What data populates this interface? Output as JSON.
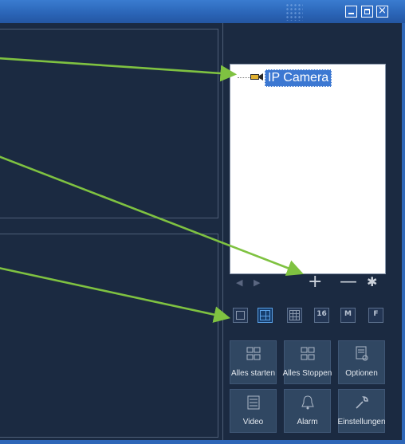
{
  "window": {
    "controls": {
      "minimize_icon": "minimize-icon",
      "maximize_icon": "maximize-icon",
      "close_label": "×"
    }
  },
  "tree": {
    "items": [
      {
        "label": "IP Camera",
        "icon": "camera-icon",
        "selected": true
      }
    ]
  },
  "list_controls": {
    "first_label": "◀",
    "last_label": "▶",
    "add_label": "+",
    "remove_label": "—",
    "settings_label": "✱"
  },
  "layouts": [
    {
      "name": "single",
      "text": ""
    },
    {
      "name": "quad",
      "text": "",
      "selected": true
    },
    {
      "name": "nine",
      "text": ""
    },
    {
      "name": "sixteen",
      "text": "16"
    },
    {
      "name": "m",
      "text": "M"
    },
    {
      "name": "f",
      "text": "F"
    }
  ],
  "buttons": {
    "start_all": "Alles starten",
    "stop_all": "Alles Stoppen",
    "options": "Optionen",
    "video": "Video",
    "alarm": "Alarm",
    "settings": "Einstellungen"
  },
  "colors": {
    "panel_bg": "#1b2a41",
    "title_bar": "#2a64b6",
    "selection": "#3c78d2",
    "annotation_arrow": "#7fc241",
    "button_bg": "#304762"
  }
}
